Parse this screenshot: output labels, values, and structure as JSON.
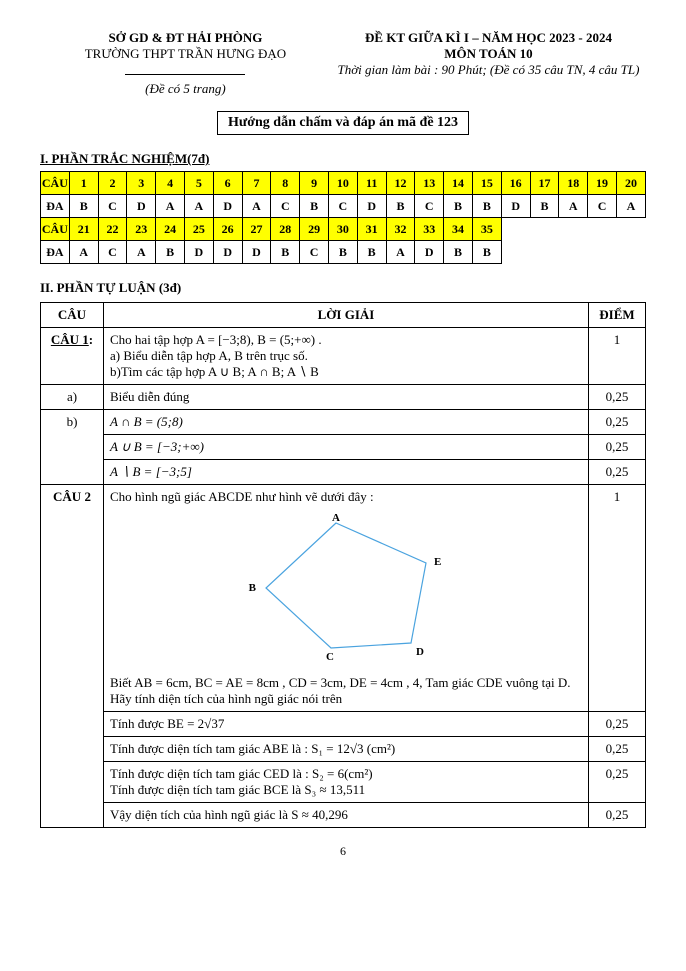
{
  "header": {
    "dept": "SỞ GD & ĐT HẢI PHÒNG",
    "school": "TRƯỜNG THPT TRẦN HƯNG ĐẠO",
    "pages_note": "(Đề có 5 trang)",
    "exam_title": "ĐỀ KT GIỮA KÌ I – NĂM HỌC 2023 - 2024",
    "subject": "MÔN TOÁN 10",
    "duration": "Thời gian làm bài : 90 Phút; (Đề có 35 câu TN, 4 câu TL)",
    "main_title": "Hướng dẫn chấm và đáp án mã đề 123"
  },
  "section1": {
    "title": "I.   PHẦN TRẮC NGHIỆM(7đ)",
    "labels": {
      "cau": "CÂU",
      "da": "ĐA"
    },
    "row1": {
      "nums": [
        "1",
        "2",
        "3",
        "4",
        "5",
        "6",
        "7",
        "8",
        "9",
        "10",
        "11",
        "12",
        "13",
        "14",
        "15",
        "16",
        "17",
        "18",
        "19",
        "20"
      ],
      "ans": [
        "B",
        "C",
        "D",
        "A",
        "A",
        "D",
        "A",
        "C",
        "B",
        "C",
        "D",
        "B",
        "C",
        "B",
        "B",
        "D",
        "B",
        "A",
        "C",
        "A"
      ]
    },
    "row2": {
      "nums": [
        "21",
        "22",
        "23",
        "24",
        "25",
        "26",
        "27",
        "28",
        "29",
        "30",
        "31",
        "32",
        "33",
        "34",
        "35"
      ],
      "ans": [
        "A",
        "C",
        "A",
        "B",
        "D",
        "D",
        "D",
        "B",
        "C",
        "B",
        "B",
        "A",
        "D",
        "B",
        "B"
      ]
    }
  },
  "section2": {
    "title": "II. PHẦN TỰ LUẬN (3đ)",
    "headers": {
      "cau": "CÂU",
      "loigiai": "LỜI GIẢI",
      "diem": "ĐIỂM"
    },
    "q1": {
      "label": "CÂU 1",
      "intro": "Cho hai tập hợp  A = [−3;8), B = (5;+∞) .",
      "a_line": "a) Biểu diễn tập hợp A, B trên trục số.",
      "b_line": "b)Tìm các tập hợp A ∪ B; A ∩ B; A ∖ B",
      "pt_intro": "1",
      "rows": [
        {
          "lab": "a)",
          "txt": "Biểu diễn đúng",
          "pt": "0,25"
        },
        {
          "lab": "b)",
          "txt": "A ∩ B = (5;8)",
          "pt": "0,25"
        },
        {
          "lab": "",
          "txt": "A ∪ B = [−3;+∞)",
          "pt": "0,25"
        },
        {
          "lab": "",
          "txt": "A ∖ B = [−3;5]",
          "pt": "0,25"
        }
      ]
    },
    "q2": {
      "label": "CÂU 2",
      "intro": "Cho hình ngũ giác ABCDE như hình vẽ dưới đây :",
      "given": "Biết  AB = 6cm,  BC = AE = 8cm ,  CD = 3cm, DE = 4cm , 4, Tam giác CDE vuông tại D. Hãy tính diện tích của hình ngũ giác nói trên",
      "pt_intro": "1",
      "rows": [
        {
          "txt": "Tính được  BE = 2√37",
          "pt": "0,25"
        },
        {
          "txt": "Tính được diện tích tam giác ABE là :  S₁ = 12√3 (cm²)",
          "pt": "0,25"
        },
        {
          "txt": "Tính được diện tích tam giác CED là :  S₂ = 6(cm²)",
          "pt": "0,25"
        },
        {
          "txt2": "Tính được diện tích tam giác BCE là  S₃ ≈ 13,511"
        },
        {
          "txt": "Vậy diện tích của hình ngũ giác là  S ≈ 40,296",
          "pt": "0,25"
        }
      ]
    }
  },
  "page_number": "6"
}
